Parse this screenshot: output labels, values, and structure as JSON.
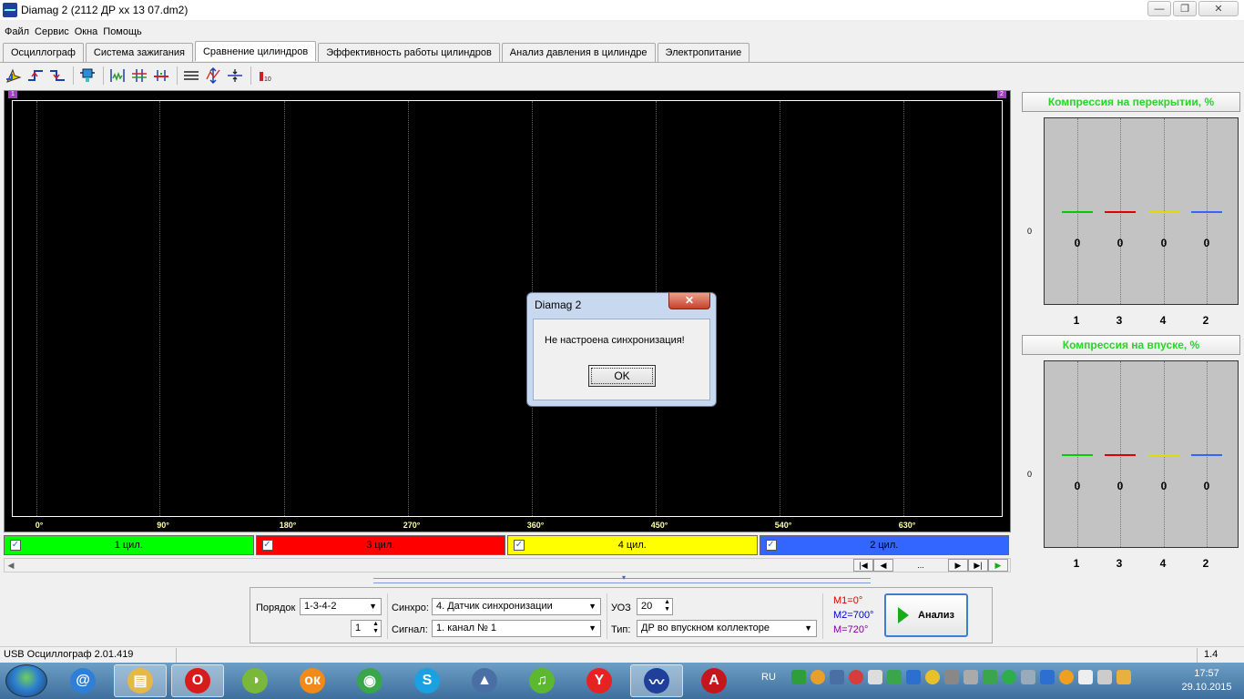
{
  "window": {
    "title": "Diamag 2 (2112 ДР хх 13 07.dm2)",
    "minimize": "—",
    "maximize": "❐",
    "close": "✕"
  },
  "menu": [
    "Файл",
    "Сервис",
    "Окна",
    "Помощь"
  ],
  "tabs": [
    {
      "label": "Осциллограф",
      "active": false
    },
    {
      "label": "Система зажигания",
      "active": false
    },
    {
      "label": "Сравнение цилиндров",
      "active": true
    },
    {
      "label": "Эффективность работы цилиндров",
      "active": false
    },
    {
      "label": "Анализ давления в цилиндре",
      "active": false
    },
    {
      "label": "Электропитание",
      "active": false
    }
  ],
  "toolbar_icons": [
    "cursor-icon",
    "rise-edge-icon",
    "fall-edge-icon",
    "cylinder-icon",
    "sync-marks-icon",
    "marks-split-icon",
    "marks-shift-icon",
    "lines-icon",
    "vertical-scale-icon",
    "horizontal-scale-icon",
    "bar-value-icon"
  ],
  "oscillogram": {
    "corner_left": "1",
    "corner_right": "2",
    "axis_labels": [
      "0°",
      "90°",
      "180°",
      "270°",
      "360°",
      "450°",
      "540°",
      "630°"
    ]
  },
  "cylinders": [
    {
      "label": "1 цил.",
      "color": "#00ff00",
      "checked": true
    },
    {
      "label": "3 цил.",
      "color": "#ff0000",
      "checked": true
    },
    {
      "label": "4 цил.",
      "color": "#ffff00",
      "checked": true
    },
    {
      "label": "2 цил.",
      "color": "#3366ff",
      "checked": true
    }
  ],
  "navigation": {
    "first": "|◀",
    "prev": "◀",
    "position": "...",
    "next": "▶",
    "last": "▶|",
    "play": "▶"
  },
  "panels": [
    {
      "title": "Компрессия на перекрытии, %",
      "zero_label": "0",
      "categories": [
        "1",
        "3",
        "4",
        "2"
      ],
      "values": [
        "0",
        "0",
        "0",
        "0"
      ],
      "colors": [
        "#00cc00",
        "#dd0000",
        "#dddd00",
        "#3366ff"
      ]
    },
    {
      "title": "Компрессия на впуске, %",
      "zero_label": "0",
      "categories": [
        "1",
        "3",
        "4",
        "2"
      ],
      "values": [
        "0",
        "0",
        "0",
        "0"
      ],
      "colors": [
        "#00cc00",
        "#dd0000",
        "#dddd00",
        "#3366ff"
      ]
    }
  ],
  "controls": {
    "order_label": "Порядок",
    "order_value": "1-3-4-2",
    "order_spin": "1",
    "sync_label": "Синхро:",
    "sync_value": "4.  Датчик синхронизации",
    "signal_label": "Сигнал:",
    "signal_value": "1.  канал № 1",
    "uoz_label": "УОЗ",
    "uoz_value": "20",
    "type_label": "Тип:",
    "type_value": "ДР во впускном коллекторе",
    "m1": "M1=0°",
    "m2": "M2=700°",
    "m3": "M=720°",
    "m1_color": "#dd0000",
    "m2_color": "#0000cc",
    "m3_color": "#8000a0",
    "analyze_label": "Анализ"
  },
  "status": {
    "device": "USB Осциллограф  2.01.419",
    "right": "1.4"
  },
  "dialog": {
    "title": "Diamag 2",
    "message": "Не настроена синхронизация!",
    "ok_label": "OK",
    "close": "✕"
  },
  "taskbar": {
    "language": "RU",
    "time": "17:57",
    "date": "29.10.2015",
    "apps": [
      {
        "name": "mail-icon",
        "glyph": "@",
        "color": "#2f7fd8",
        "active": false
      },
      {
        "name": "explorer-icon",
        "glyph": "▤",
        "color": "#e5b84a",
        "active": true
      },
      {
        "name": "opera-icon",
        "glyph": "O",
        "color": "#d81c1c",
        "active": true
      },
      {
        "name": "app-icon",
        "glyph": "◑",
        "color": "#79b83a",
        "active": false
      },
      {
        "name": "odnoklassniki-icon",
        "glyph": "ок",
        "color": "#f28a1b",
        "active": false
      },
      {
        "name": "chrome-icon",
        "glyph": "◉",
        "color": "#3aa54a",
        "active": false
      },
      {
        "name": "skype-icon",
        "glyph": "S",
        "color": "#1ba0e2",
        "active": false
      },
      {
        "name": "diag-icon",
        "glyph": "▲",
        "color": "#4a6fa5",
        "active": false
      },
      {
        "name": "music-icon",
        "glyph": "♫",
        "color": "#5cb82e",
        "active": false
      },
      {
        "name": "yandex-icon",
        "glyph": "Y",
        "color": "#e62222",
        "active": false
      },
      {
        "name": "diamag-icon",
        "glyph": "〰",
        "color": "#1f3f9a",
        "active": true
      },
      {
        "name": "pdf-icon",
        "glyph": "A",
        "color": "#c4161c",
        "active": false
      }
    ]
  }
}
